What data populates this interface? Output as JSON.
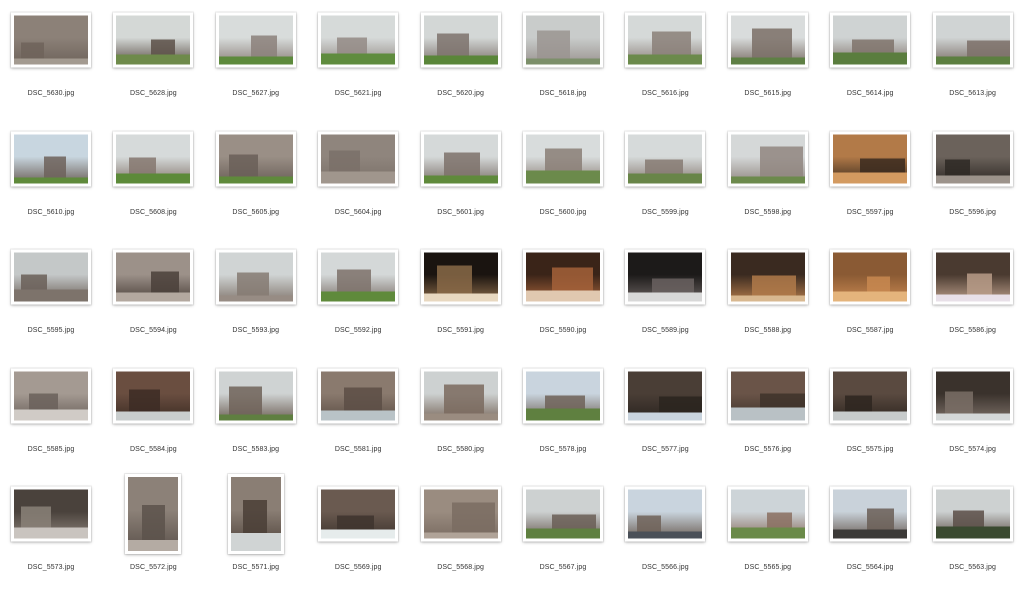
{
  "files": [
    {
      "name": "DSC_5630.jpg",
      "orient": "landscape",
      "palette": [
        "#8c8178",
        "#6e635b",
        "#a39a90"
      ]
    },
    {
      "name": "DSC_5628.jpg",
      "orient": "landscape",
      "palette": [
        "#d4d8d6",
        "#5c5048",
        "#6e8a4a"
      ]
    },
    {
      "name": "DSC_5627.jpg",
      "orient": "landscape",
      "palette": [
        "#d8dcdb",
        "#8b807a",
        "#5d8a3c"
      ]
    },
    {
      "name": "DSC_5621.jpg",
      "orient": "landscape",
      "palette": [
        "#d6dad9",
        "#938a85",
        "#5f8c3e"
      ]
    },
    {
      "name": "DSC_5620.jpg",
      "orient": "landscape",
      "palette": [
        "#d3d7d6",
        "#7d726c",
        "#5a8639"
      ]
    },
    {
      "name": "DSC_5618.jpg",
      "orient": "landscape",
      "palette": [
        "#c9cccb",
        "#9a9490",
        "#7c8f6a"
      ]
    },
    {
      "name": "DSC_5616.jpg",
      "orient": "landscape",
      "palette": [
        "#d5d9d8",
        "#8a7f78",
        "#6b8a4b"
      ]
    },
    {
      "name": "DSC_5615.jpg",
      "orient": "landscape",
      "palette": [
        "#d9dcdc",
        "#7a6e66",
        "#5e7f44"
      ]
    },
    {
      "name": "DSC_5614.jpg",
      "orient": "landscape",
      "palette": [
        "#cfd3d3",
        "#7f736b",
        "#5a7d3e"
      ]
    },
    {
      "name": "DSC_5613.jpg",
      "orient": "landscape",
      "palette": [
        "#d0d4d4",
        "#7b6f67",
        "#5c7f40"
      ]
    },
    {
      "name": "DSC_5610.jpg",
      "orient": "landscape",
      "palette": [
        "#c8d6e0",
        "#6d625a",
        "#5f8a3b"
      ]
    },
    {
      "name": "DSC_5608.jpg",
      "orient": "landscape",
      "palette": [
        "#d6dada",
        "#85776e",
        "#5c8a39"
      ]
    },
    {
      "name": "DSC_5605.jpg",
      "orient": "landscape",
      "palette": [
        "#9a8f86",
        "#6a5f58",
        "#5f8a3b"
      ]
    },
    {
      "name": "DSC_5604.jpg",
      "orient": "landscape",
      "palette": [
        "#8f857d",
        "#7a7068",
        "#a0968d"
      ]
    },
    {
      "name": "DSC_5601.jpg",
      "orient": "landscape",
      "palette": [
        "#d5d9d9",
        "#7c716a",
        "#5f8a3b"
      ]
    },
    {
      "name": "DSC_5600.jpg",
      "orient": "landscape",
      "palette": [
        "#d8dcdc",
        "#8a7e76",
        "#6b8a4b"
      ]
    },
    {
      "name": "DSC_5599.jpg",
      "orient": "landscape",
      "palette": [
        "#d6dada",
        "#867a72",
        "#688548"
      ]
    },
    {
      "name": "DSC_5598.jpg",
      "orient": "landscape",
      "palette": [
        "#d5d8d8",
        "#908680",
        "#6c8a4c"
      ]
    },
    {
      "name": "DSC_5597.jpg",
      "orient": "landscape",
      "palette": [
        "#b27a48",
        "#3a2a1e",
        "#d39a60"
      ]
    },
    {
      "name": "DSC_5596.jpg",
      "orient": "landscape",
      "palette": [
        "#6b625b",
        "#2e2925",
        "#9c938b"
      ]
    },
    {
      "name": "DSC_5595.jpg",
      "orient": "landscape",
      "palette": [
        "#c4c8c8",
        "#6a5f58",
        "#7d736b"
      ]
    },
    {
      "name": "DSC_5594.jpg",
      "orient": "landscape",
      "palette": [
        "#9c9189",
        "#4a403a",
        "#b3a89f"
      ]
    },
    {
      "name": "DSC_5593.jpg",
      "orient": "landscape",
      "palette": [
        "#d0d4d4",
        "#857a72",
        "#978c84"
      ]
    },
    {
      "name": "DSC_5592.jpg",
      "orient": "landscape",
      "palette": [
        "#d4d8d8",
        "#7c716a",
        "#5f8a3b"
      ]
    },
    {
      "name": "DSC_5591.jpg",
      "orient": "landscape",
      "palette": [
        "#1a1410",
        "#8a6a48",
        "#e8d8c0"
      ]
    },
    {
      "name": "DSC_5590.jpg",
      "orient": "landscape",
      "palette": [
        "#3a2418",
        "#a4623a",
        "#e0c8b0"
      ]
    },
    {
      "name": "DSC_5589.jpg",
      "orient": "landscape",
      "palette": [
        "#1c1a19",
        "#6a6260",
        "#d8d8d8"
      ]
    },
    {
      "name": "DSC_5588.jpg",
      "orient": "landscape",
      "palette": [
        "#3a2a20",
        "#b07a4a",
        "#d8b890"
      ]
    },
    {
      "name": "DSC_5587.jpg",
      "orient": "landscape",
      "palette": [
        "#8a5a34",
        "#c88850",
        "#e4b47c"
      ]
    },
    {
      "name": "DSC_5586.jpg",
      "orient": "landscape",
      "palette": [
        "#4a3a30",
        "#b89c88",
        "#e8e0e8"
      ]
    },
    {
      "name": "DSC_5585.jpg",
      "orient": "landscape",
      "palette": [
        "#a49a92",
        "#6a605a",
        "#d0cbc6"
      ]
    },
    {
      "name": "DSC_5584.jpg",
      "orient": "landscape",
      "palette": [
        "#6a4e40",
        "#3c2c24",
        "#c9cdcd"
      ]
    },
    {
      "name": "DSC_5583.jpg",
      "orient": "landscape",
      "palette": [
        "#cfd3d3",
        "#6f6258",
        "#5f7f40"
      ]
    },
    {
      "name": "DSC_5581.jpg",
      "orient": "landscape",
      "palette": [
        "#8a7a6e",
        "#5c4e45",
        "#b9c3c7"
      ]
    },
    {
      "name": "DSC_5580.jpg",
      "orient": "landscape",
      "palette": [
        "#cdd1d1",
        "#7a6a5e",
        "#9a8c80"
      ]
    },
    {
      "name": "DSC_5578.jpg",
      "orient": "landscape",
      "palette": [
        "#c9d4de",
        "#6e6258",
        "#5f8040"
      ]
    },
    {
      "name": "DSC_5577.jpg",
      "orient": "landscape",
      "palette": [
        "#4a3e36",
        "#2a241f",
        "#c9d4de"
      ]
    },
    {
      "name": "DSC_5576.jpg",
      "orient": "landscape",
      "palette": [
        "#6a5448",
        "#3e322a",
        "#b9c1c5"
      ]
    },
    {
      "name": "DSC_5575.jpg",
      "orient": "landscape",
      "palette": [
        "#5a4a40",
        "#2e2620",
        "#c7cbcb"
      ]
    },
    {
      "name": "DSC_5574.jpg",
      "orient": "landscape",
      "palette": [
        "#3a322c",
        "#7a6e66",
        "#d4d8d8"
      ]
    },
    {
      "name": "DSC_5573.jpg",
      "orient": "landscape",
      "palette": [
        "#4a423c",
        "#8a8178",
        "#c9c4bf"
      ]
    },
    {
      "name": "DSC_5572.jpg",
      "orient": "portrait",
      "palette": [
        "#8c8178",
        "#5c524b",
        "#b4aba3"
      ]
    },
    {
      "name": "DSC_5571.jpg",
      "orient": "portrait",
      "palette": [
        "#8a7e74",
        "#4a3e36",
        "#d0d4d4"
      ]
    },
    {
      "name": "DSC_5569.jpg",
      "orient": "landscape",
      "palette": [
        "#6a5a50",
        "#3e342e",
        "#e6ecec"
      ]
    },
    {
      "name": "DSC_5568.jpg",
      "orient": "landscape",
      "palette": [
        "#9a8c80",
        "#7a6c62",
        "#b0a398"
      ]
    },
    {
      "name": "DSC_5567.jpg",
      "orient": "landscape",
      "palette": [
        "#cdd1d1",
        "#6a5e56",
        "#5f8040"
      ]
    },
    {
      "name": "DSC_5566.jpg",
      "orient": "landscape",
      "palette": [
        "#c9d4de",
        "#6e6258",
        "#4a5058"
      ]
    },
    {
      "name": "DSC_5565.jpg",
      "orient": "landscape",
      "palette": [
        "#cdd4d8",
        "#8a6e60",
        "#6a8a48"
      ]
    },
    {
      "name": "DSC_5564.jpg",
      "orient": "landscape",
      "palette": [
        "#c9d2da",
        "#6a5e56",
        "#3c3a38"
      ]
    },
    {
      "name": "DSC_5563.jpg",
      "orient": "landscape",
      "palette": [
        "#cdd1d1",
        "#5a4e46",
        "#3a4a30"
      ]
    }
  ]
}
